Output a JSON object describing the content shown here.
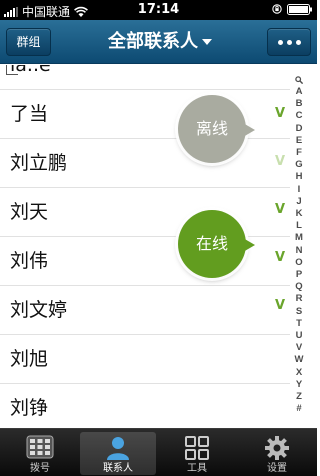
{
  "status_bar": {
    "carrier": "中国联通",
    "time": "17:14"
  },
  "nav": {
    "group_button": "群组",
    "title": "全部联系人"
  },
  "contacts": [
    {
      "name": "ia..e",
      "status": "none"
    },
    {
      "name": "了当",
      "status": "online"
    },
    {
      "name": "刘立鹏",
      "status": "offline"
    },
    {
      "name": "刘天",
      "status": "online"
    },
    {
      "name": "刘伟",
      "status": "online"
    },
    {
      "name": "刘文婷",
      "status": "online"
    },
    {
      "name": "刘旭",
      "status": "none"
    },
    {
      "name": "刘铮",
      "status": "none"
    }
  ],
  "legend": {
    "offline_label": "离线",
    "online_label": "在线"
  },
  "index_letters": [
    "A",
    "B",
    "C",
    "D",
    "E",
    "F",
    "G",
    "H",
    "I",
    "J",
    "K",
    "L",
    "M",
    "N",
    "O",
    "P",
    "Q",
    "R",
    "S",
    "T",
    "U",
    "V",
    "W",
    "X",
    "Y",
    "Z",
    "#"
  ],
  "tabs": [
    {
      "label": "拨号",
      "icon": "dialpad-icon",
      "active": false
    },
    {
      "label": "联系人",
      "icon": "contacts-icon",
      "active": true
    },
    {
      "label": "工具",
      "icon": "tools-grid-icon",
      "active": false
    },
    {
      "label": "设置",
      "icon": "gear-icon",
      "active": false
    }
  ],
  "colors": {
    "nav_bar": "#1a5a84",
    "online": "#629d1f",
    "offline": "#a9aba0",
    "check": "#6aa52c"
  }
}
